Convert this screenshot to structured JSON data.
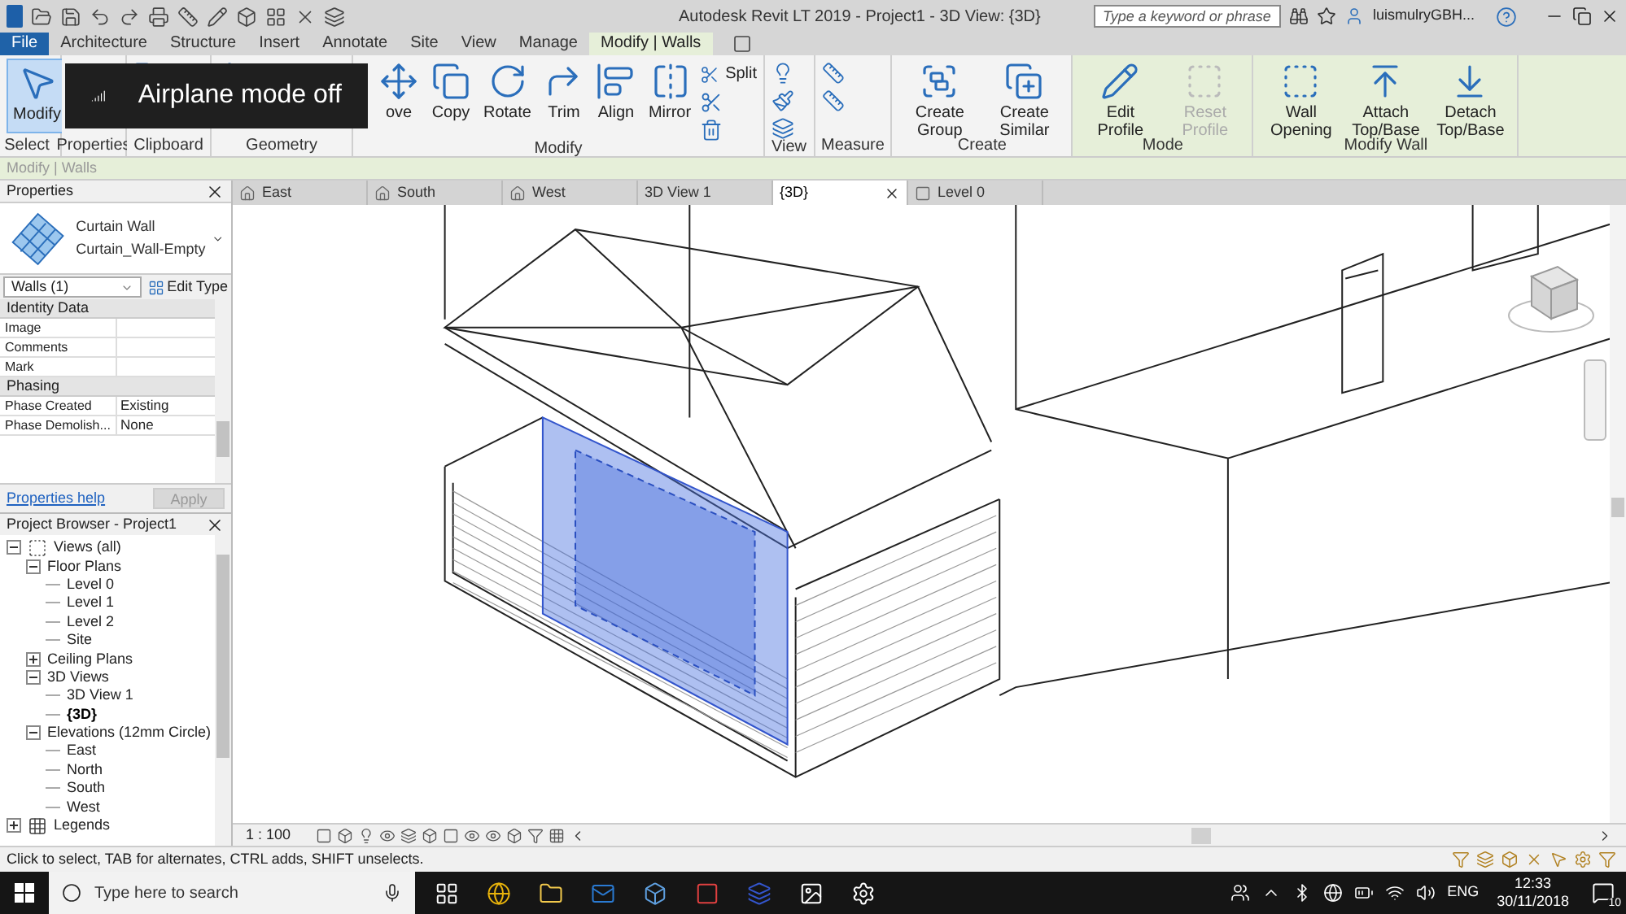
{
  "window": {
    "title": "Autodesk Revit LT 2019 - Project1 - 3D View: {3D}"
  },
  "search": {
    "placeholder": "Type a keyword or phrase"
  },
  "user": {
    "name": "luismulryGBH..."
  },
  "ribbon_tabs": [
    {
      "label": "File",
      "kind": "file",
      "selected": false
    },
    {
      "label": "Architecture",
      "kind": "tab",
      "selected": false
    },
    {
      "label": "Structure",
      "kind": "tab",
      "selected": false
    },
    {
      "label": "Insert",
      "kind": "tab",
      "selected": false
    },
    {
      "label": "Annotate",
      "kind": "tab",
      "selected": false
    },
    {
      "label": "Site",
      "kind": "tab",
      "selected": false
    },
    {
      "label": "View",
      "kind": "tab",
      "selected": false
    },
    {
      "label": "Manage",
      "kind": "tab",
      "selected": false
    },
    {
      "label": "Modify | Walls",
      "kind": "context",
      "selected": true
    }
  ],
  "ribbon_panels": [
    {
      "title": "Select",
      "kind": "select",
      "buttons": [
        {
          "label": "Modify",
          "active": true
        }
      ]
    },
    {
      "title": "Properties",
      "kind": "properties"
    },
    {
      "title": "Clipboard",
      "kind": "clipboard"
    },
    {
      "title": "Geometry",
      "kind": "geometry"
    },
    {
      "title": "Modify",
      "kind": "modify",
      "buttons": [
        {
          "label": "ove"
        },
        {
          "label": "Copy"
        },
        {
          "label": "Rotate"
        },
        {
          "label": "Trim"
        },
        {
          "label": "Align"
        },
        {
          "label": "Mirror"
        }
      ],
      "tools": [
        {
          "label": "Split"
        }
      ]
    },
    {
      "title": "View",
      "kind": "view"
    },
    {
      "title": "Measure",
      "kind": "measure"
    },
    {
      "title": "Create",
      "kind": "create",
      "buttons": [
        {
          "label": "Create Group"
        },
        {
          "label": "Create Similar"
        }
      ]
    },
    {
      "title": "Mode",
      "kind": "mode",
      "contextual": true,
      "buttons": [
        {
          "label": "Edit Profile",
          "disabled": false
        },
        {
          "label": "Reset Profile",
          "disabled": true
        }
      ]
    },
    {
      "title": "Modify Wall",
      "kind": "wall",
      "contextual": true,
      "buttons": [
        {
          "label": "Wall Opening"
        },
        {
          "label": "Attach Top/Base"
        },
        {
          "label": "Detach Top/Base"
        }
      ]
    }
  ],
  "options_bar": {
    "text": "Modify | Walls"
  },
  "toast": {
    "text": "Airplane mode off"
  },
  "properties": {
    "title": "Properties",
    "type_name": "Curtain Wall",
    "type_detail": "Curtain_Wall-Empty",
    "filter": "Walls (1)",
    "edit_type": "Edit Type",
    "groups": [
      {
        "title": "Identity Data",
        "rows": [
          {
            "label": "Image"
          },
          {
            "label": "Comments"
          },
          {
            "label": "Mark"
          }
        ]
      },
      {
        "title": "Phasing",
        "rows": [
          {
            "label": "Phase Created",
            "value": "Existing"
          },
          {
            "label": "Phase Demolish...",
            "value": "None"
          }
        ]
      }
    ],
    "help": "Properties help",
    "apply": {
      "label": "Apply",
      "disabled": true
    }
  },
  "project_browser": {
    "title": "Project Browser - Project1",
    "tree": [
      {
        "label": "Views (all)",
        "kind": "views",
        "expanded": true,
        "children": [
          {
            "label": "Floor Plans",
            "expanded": true,
            "children": [
              {
                "label": "Level 0",
                "selected": false
              },
              {
                "label": "Level 1",
                "selected": false
              },
              {
                "label": "Level 2",
                "selected": false
              },
              {
                "label": "Site",
                "selected": false
              }
            ]
          },
          {
            "label": "Ceiling Plans",
            "expanded": false
          },
          {
            "label": "3D Views",
            "expanded": true,
            "children": [
              {
                "label": "3D View 1",
                "selected": false
              },
              {
                "label": "{3D}",
                "selected": true
              }
            ]
          },
          {
            "label": "Elevations (12mm Circle)",
            "expanded": true,
            "children": [
              {
                "label": "East",
                "selected": false
              },
              {
                "label": "North",
                "selected": false
              },
              {
                "label": "South",
                "selected": false
              },
              {
                "label": "West",
                "selected": false
              }
            ]
          }
        ]
      },
      {
        "label": "Legends",
        "kind": "legends",
        "expanded": false
      }
    ]
  },
  "view_tabs": [
    {
      "label": "East",
      "kind": "elevation",
      "selected": false
    },
    {
      "label": "South",
      "kind": "elevation",
      "selected": false
    },
    {
      "label": "West",
      "kind": "elevation",
      "selected": false
    },
    {
      "label": "3D View 1",
      "kind": "threed",
      "selected": false
    },
    {
      "label": "{3D}",
      "kind": "threed",
      "selected": true
    },
    {
      "label": "Level 0",
      "kind": "plan",
      "selected": false
    }
  ],
  "view_control": {
    "scale": "1 : 100"
  },
  "status_bar": {
    "text": "Click to select, TAB for alternates, CTRL adds, SHIFT unselects."
  },
  "taskbar": {
    "search_placeholder": "Type here to search",
    "language": "ENG",
    "time": "12:33",
    "date": "30/11/2018",
    "notifications": "10"
  }
}
